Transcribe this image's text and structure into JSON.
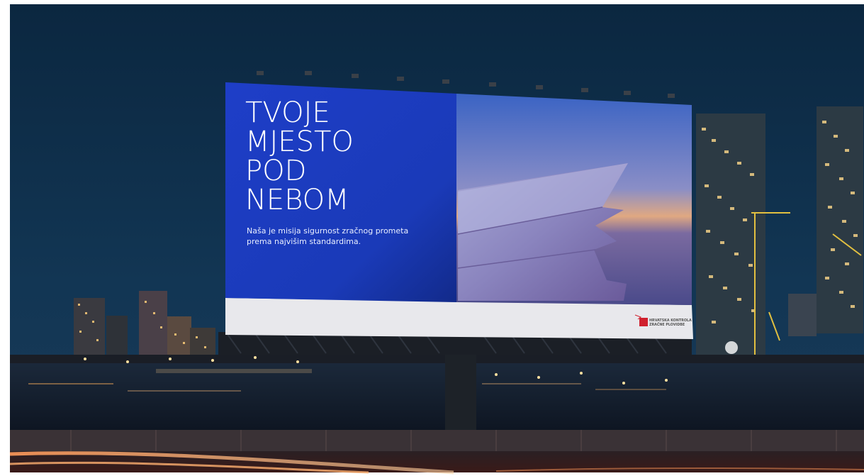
{
  "billboard": {
    "headline_lines": [
      "TVOJE",
      "MJESTO",
      "POD",
      "NEBOM"
    ],
    "subline_1": "Naša je misija sigurnost zračnog prometa",
    "subline_2": "prema najvišim standardima.",
    "logo": {
      "line_1": "HRVATSKA KONTROLA",
      "line_2": "ZRAČNE PLOVIDBE",
      "brand_color": "#d0202e"
    }
  },
  "colors": {
    "sky": "#0d2a44",
    "panel_blue": "#1a3bc4",
    "strip": "#e8e8ec"
  }
}
